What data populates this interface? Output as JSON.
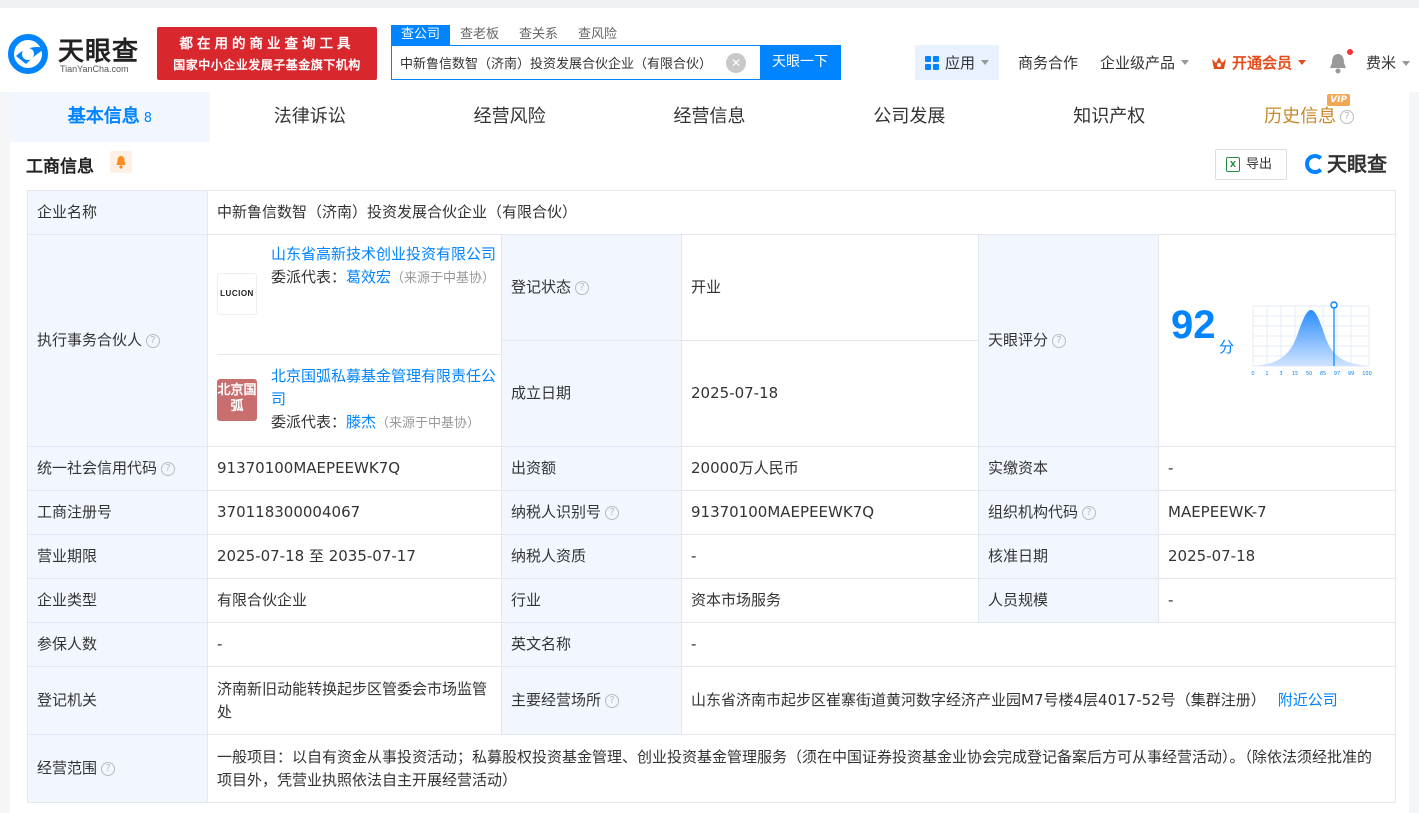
{
  "brand": {
    "name": "天眼查",
    "domain": "TianYanCha.com",
    "colors": {
      "accent": "#0084ff",
      "promo_red": "#d9272e",
      "open_green": "#12b84a",
      "vip_orange": "#e34d1c"
    }
  },
  "promo": {
    "line1": "都在用的商业查询工具",
    "line2": "国家中小企业发展子基金旗下机构"
  },
  "search": {
    "tabs": [
      "查公司",
      "查老板",
      "查关系",
      "查风险"
    ],
    "value": "中新鲁信数智（济南）投资发展合伙企业（有限合伙）",
    "button": "天眼一下"
  },
  "nav": {
    "app": "应用",
    "business": "商务合作",
    "enterprise": "企业级产品",
    "vip": "开通会员",
    "user": "费米",
    "icons": [
      "grid-icon",
      "crown-icon",
      "bell-icon"
    ]
  },
  "tabs": [
    {
      "label": "基本信息",
      "count": "8"
    },
    {
      "label": "法律诉讼"
    },
    {
      "label": "经营风险"
    },
    {
      "label": "经营信息"
    },
    {
      "label": "公司发展"
    },
    {
      "label": "知识产权"
    },
    {
      "label": "历史信息",
      "badge": "VIP"
    }
  ],
  "section": {
    "title": "工商信息",
    "export": "导出",
    "brand": "天眼查",
    "help_glyph": "?"
  },
  "info": {
    "company_name": {
      "label": "企业名称",
      "value": "中新鲁信数智（济南）投资发展合伙企业（有限合伙）"
    },
    "partners": {
      "label": "执行事务合伙人",
      "items": [
        {
          "logo": "LUCION",
          "name": "山东省高新技术创业投资有限公司",
          "rep_label": "委派代表：",
          "rep": "葛效宏",
          "note": "（来源于中基协）"
        },
        {
          "logo": "北京国弧",
          "name": "北京国弧私募基金管理有限责任公司",
          "rep_label": "委派代表：",
          "rep": "滕杰",
          "note": "（来源于中基协）"
        }
      ]
    },
    "status": {
      "label": "登记状态",
      "value": "开业"
    },
    "established": {
      "label": "成立日期",
      "value": "2025-07-18"
    },
    "score": {
      "label": "天眼评分",
      "value": "92",
      "unit": "分",
      "axis_ticks": [
        "0",
        "1",
        "3",
        "15",
        "50",
        "85",
        "97",
        "99",
        "100"
      ]
    },
    "credit_code": {
      "label": "统一社会信用代码",
      "value": "91370100MAEPEEWK7Q"
    },
    "capital": {
      "label": "出资额",
      "value": "20000万人民币"
    },
    "paid_capital": {
      "label": "实缴资本",
      "value": "-"
    },
    "reg_no": {
      "label": "工商注册号",
      "value": "370118300004067"
    },
    "tax_id": {
      "label": "纳税人识别号",
      "value": "91370100MAEPEEWK7Q"
    },
    "org_code": {
      "label": "组织机构代码",
      "value": "MAEPEEWK-7"
    },
    "term": {
      "label": "营业期限",
      "value": "2025-07-18 至 2035-07-17"
    },
    "tax_qual": {
      "label": "纳税人资质",
      "value": "-"
    },
    "approve_date": {
      "label": "核准日期",
      "value": "2025-07-18"
    },
    "type": {
      "label": "企业类型",
      "value": "有限合伙企业"
    },
    "industry": {
      "label": "行业",
      "value": "资本市场服务"
    },
    "staff": {
      "label": "人员规模",
      "value": "-"
    },
    "insured": {
      "label": "参保人数",
      "value": "-"
    },
    "english_name": {
      "label": "英文名称",
      "value": "-"
    },
    "authority": {
      "label": "登记机关",
      "value": "济南新旧动能转换起步区管委会市场监管处"
    },
    "address": {
      "label": "主要经营场所",
      "value": "山东省济南市起步区崔寨街道黄河数字经济产业园M7号楼4层4017-52号（集群注册）",
      "link": "附近公司"
    },
    "scope": {
      "label": "经营范围",
      "value": "一般项目：以自有资金从事投资活动；私募股权投资基金管理、创业投资基金管理服务（须在中国证券投资基金业协会完成登记备案后方可从事经营活动）。（除依法须经批准的项目外，凭营业执照依法自主开展经营活动）"
    }
  }
}
